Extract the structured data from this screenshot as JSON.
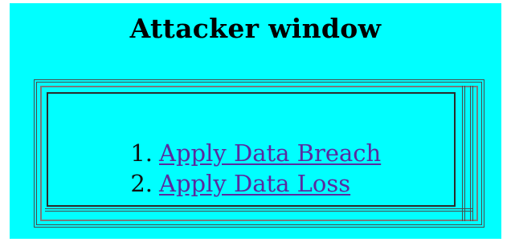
{
  "window": {
    "title": "Attacker window"
  },
  "links": [
    {
      "number": "1.",
      "label": "Apply Data Breach"
    },
    {
      "number": "2.",
      "label": "Apply Data Loss"
    }
  ],
  "colors": {
    "background": "#00ffff",
    "link": "#5a2aa0",
    "text": "#000000"
  }
}
